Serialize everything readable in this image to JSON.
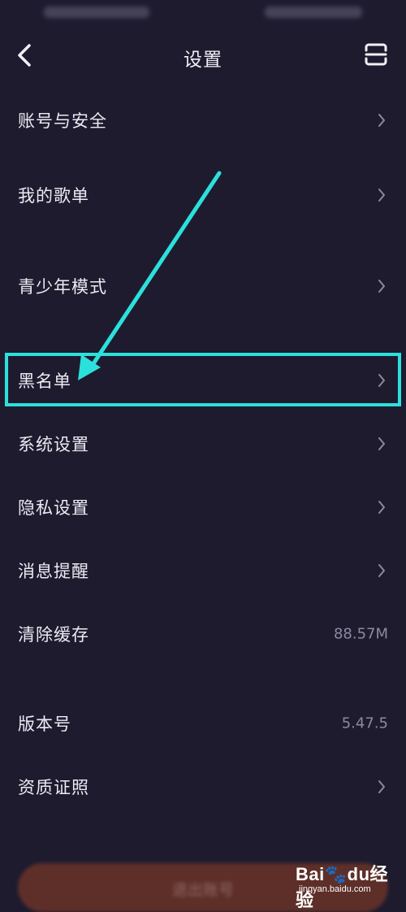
{
  "header": {
    "title": "设置",
    "back_icon": "chevron-left-icon",
    "scan_icon": "scan-icon"
  },
  "menu": {
    "items": [
      {
        "label": "账号与安全",
        "action": "chevron"
      },
      {
        "label": "我的歌单",
        "action": "chevron"
      },
      {
        "label": "青少年模式",
        "action": "chevron"
      },
      {
        "label": "黑名单",
        "action": "chevron",
        "highlighted": true
      },
      {
        "label": "系统设置",
        "action": "chevron"
      },
      {
        "label": "隐私设置",
        "action": "chevron"
      },
      {
        "label": "消息提醒",
        "action": "chevron"
      },
      {
        "label": "清除缓存",
        "value": "88.57M"
      },
      {
        "label": "版本号",
        "value": "5.47.5"
      },
      {
        "label": "资质证照",
        "action": "chevron"
      }
    ]
  },
  "logout": {
    "label": "退出账号"
  },
  "watermark": {
    "brand_part1": "Bai",
    "brand_part2": "du",
    "brand_part3": "经验",
    "sub": "jingyan.baidu.com"
  },
  "colors": {
    "background": "#1e1b2f",
    "text": "#ecebf2",
    "muted": "#8c8a9e",
    "highlight": "#2ce0dc",
    "logout": "#6a3328"
  }
}
